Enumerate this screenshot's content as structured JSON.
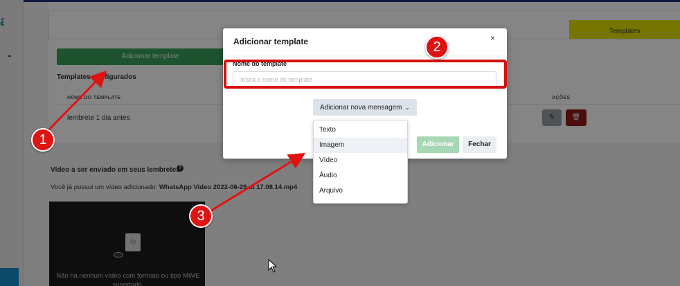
{
  "background": {
    "tabs": {
      "templates": "Templates"
    },
    "add_template_button": "Adicionar template",
    "templates_section_title": "Templates configurados",
    "table": {
      "columns": {
        "name": "NOME DO TEMPLATE",
        "actions": "AÇÕES"
      },
      "rows": [
        {
          "name": "lembrete 1 dia antes"
        }
      ]
    },
    "video": {
      "section_title": "Vídeo a ser enviado em seus lembretes",
      "help_glyph": "?",
      "current_prefix": "Você já possui um vídeo adicionado: ",
      "current_file": "WhatsApp Video 2022-06-29 at 17.08.14.mp4",
      "player_message": "Não há nenhum vídeo com formato ou tipo MIME suportado."
    }
  },
  "modal": {
    "title": "Adicionar template",
    "close_glyph": "×",
    "field_label": "Nome do template",
    "field_placeholder": "Insira o nome do template",
    "field_value": "",
    "add_message_button": "Adicionar nova mensagem",
    "submit_button": "Adicionar",
    "close_button": "Fechar"
  },
  "dropdown": {
    "options": [
      "Texto",
      "Imagem",
      "Vídeo",
      "Áudio",
      "Arquivo"
    ],
    "hovered": "Imagem"
  },
  "annotations": {
    "badges": [
      "1",
      "2",
      "3"
    ],
    "color": "#e01313"
  },
  "colors": {
    "accent_green": "#3aa05a",
    "tab_yellow": "#e1e000",
    "danger": "#8c1a1a"
  }
}
